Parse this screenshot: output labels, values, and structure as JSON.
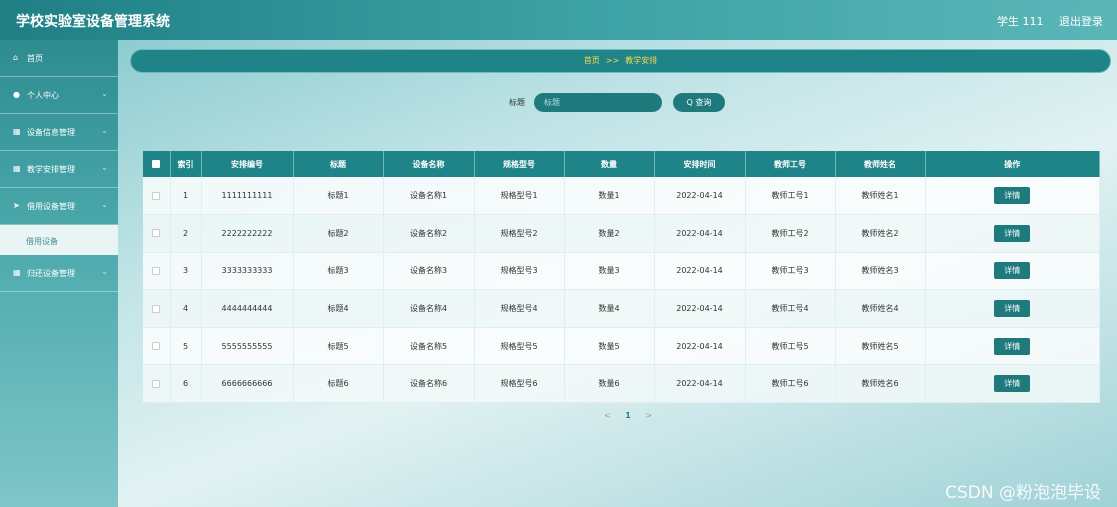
{
  "header": {
    "title": "学校实验室设备管理系统",
    "user": "学生 111",
    "logout": "退出登录"
  },
  "sidebar": {
    "items": [
      {
        "label": "首页",
        "icon": "home-icon",
        "glyph": "⌂",
        "chevron": ""
      },
      {
        "label": "个人中心",
        "icon": "user-icon",
        "glyph": "●",
        "chevron": "⌄"
      },
      {
        "label": "设备信息管理",
        "icon": "grid-icon",
        "glyph": "▦",
        "chevron": "⌄"
      },
      {
        "label": "教学安排管理",
        "icon": "grid-icon",
        "glyph": "▦",
        "chevron": "⌄"
      },
      {
        "label": "借用设备管理",
        "icon": "send-icon",
        "glyph": "➤",
        "chevron": "⌄"
      },
      {
        "label": "归还设备管理",
        "icon": "grid-icon",
        "glyph": "▦",
        "chevron": "⌄"
      }
    ],
    "submenu": {
      "label": "借用设备"
    }
  },
  "breadcrumb": {
    "home": "首页",
    "sep": ">>",
    "current": "教学安排"
  },
  "search": {
    "label": "标题",
    "placeholder": "标题",
    "button": "Q 查询"
  },
  "table": {
    "headers": [
      "索引",
      "安排编号",
      "标题",
      "设备名称",
      "规格型号",
      "数量",
      "安排时间",
      "教师工号",
      "教师姓名",
      "操作"
    ],
    "action_label": "详情",
    "rows": [
      [
        "1",
        "1111111111",
        "标题1",
        "设备名称1",
        "规格型号1",
        "数量1",
        "2022-04-14",
        "教师工号1",
        "教师姓名1"
      ],
      [
        "2",
        "2222222222",
        "标题2",
        "设备名称2",
        "规格型号2",
        "数量2",
        "2022-04-14",
        "教师工号2",
        "教师姓名2"
      ],
      [
        "3",
        "3333333333",
        "标题3",
        "设备名称3",
        "规格型号3",
        "数量3",
        "2022-04-14",
        "教师工号3",
        "教师姓名3"
      ],
      [
        "4",
        "4444444444",
        "标题4",
        "设备名称4",
        "规格型号4",
        "数量4",
        "2022-04-14",
        "教师工号4",
        "教师姓名4"
      ],
      [
        "5",
        "5555555555",
        "标题5",
        "设备名称5",
        "规格型号5",
        "数量5",
        "2022-04-14",
        "教师工号5",
        "教师姓名5"
      ],
      [
        "6",
        "6666666666",
        "标题6",
        "设备名称6",
        "规格型号6",
        "数量6",
        "2022-04-14",
        "教师工号6",
        "教师姓名6"
      ]
    ]
  },
  "pagination": {
    "prev": "<",
    "current": "1",
    "next": ">"
  },
  "watermark": "CSDN @粉泡泡毕设",
  "colors": {
    "primary": "#1f8488",
    "accent_text": "#ffd84d"
  }
}
